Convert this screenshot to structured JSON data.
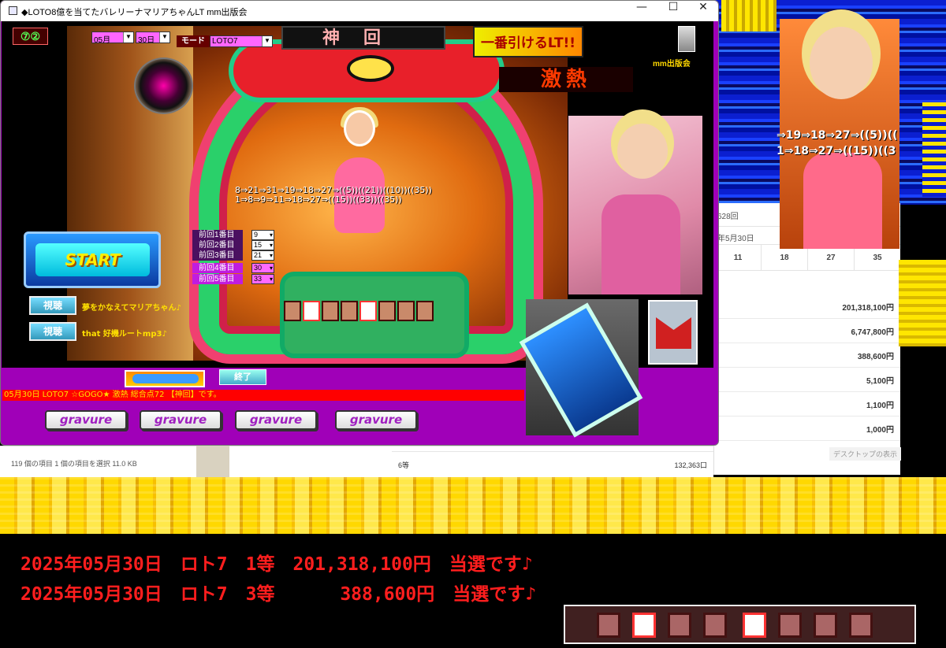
{
  "window": {
    "title": "◆LOTO8億を当てたバレリーナマリアちゃんLT mm出版会",
    "minimize": "—",
    "maximize": "☐",
    "close": "✕"
  },
  "controls": {
    "month": "05月",
    "day": "30日",
    "mode_label": "モード",
    "mode_value": "LOTO7",
    "logo_code": "⑦②"
  },
  "stage": {
    "kami_text": "神回",
    "banner_text": "一番引けるLT!!",
    "gekinetsu": "激熱",
    "publisher": "mm出版会",
    "seq1": "8⇒21⇒31⇒19⇒18⇒27⇒((5))((21))((10))((35))",
    "seq2": "1⇒8⇒9⇒11⇒18⇒27⇒((15))((33))((35))"
  },
  "start_button": "START",
  "listen": [
    {
      "label": "視聴",
      "text": "夢をかなえてマリアちゃん♪"
    },
    {
      "label": "視聴",
      "text": "that 好機ルートmp3♪"
    }
  ],
  "previous": [
    {
      "label": "前回1番目",
      "value": "9"
    },
    {
      "label": "前回2番目",
      "value": "15"
    },
    {
      "label": "前回3番目",
      "value": "21"
    },
    {
      "label": "前回4番目",
      "value": "30"
    },
    {
      "label": "前回5番目",
      "value": "33"
    }
  ],
  "end_button": "終了",
  "status_message": "05月30日  LOTO7  ☆GOGO★ 激熱  総合点72  【神回】です。",
  "gravure_buttons": [
    "gravure",
    "gravure",
    "gravure",
    "gravure"
  ],
  "photo2_lines": [
    "⇒19⇒18⇒27⇒((5))((",
    "1⇒18⇒27⇒((15))((3"
  ],
  "explorer": {
    "header": "628回",
    "draw_date": "年5月30日",
    "balls": [
      "11",
      "18",
      "27",
      "35"
    ],
    "prizes": [
      "201,318,100円",
      "6,747,800円",
      "388,600円",
      "5,100円",
      "1,100円",
      "1,000円"
    ],
    "desktop_label": "デスクトップの表示",
    "status": "119 個の項目     1 個の項目を選択  11.0 KB",
    "row6_label": "6等",
    "row6_count": "132,363口"
  },
  "results": [
    "2025年05月30日　ロト7　1等　201,318,100円　当選です♪",
    "2025年05月30日　ロト7　3等　　　 388,600円　当選です♪"
  ],
  "colors": {
    "window_bg": "#a000b8",
    "result_text": "#ff1e1e",
    "status_bar": "#ff0000"
  }
}
